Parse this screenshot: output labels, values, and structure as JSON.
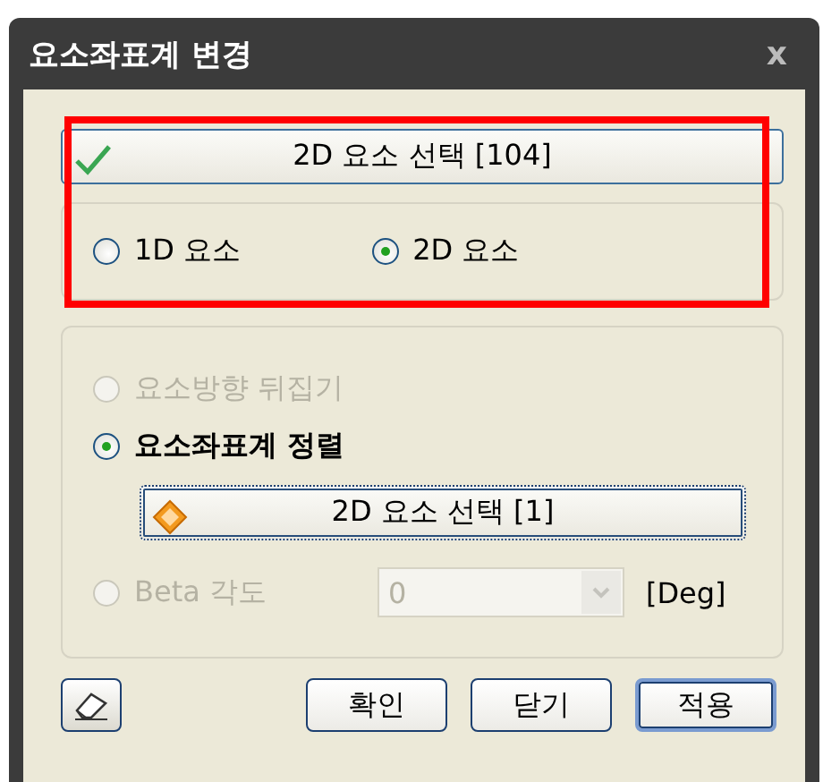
{
  "window": {
    "title": "요소좌표계 변경",
    "close": "x"
  },
  "select_button": {
    "label": "2D 요소 선택 [104]"
  },
  "element_type": [
    {
      "label": "1D 요소",
      "selected": false
    },
    {
      "label": "2D 요소",
      "selected": true
    }
  ],
  "options": [
    {
      "kind": "radio",
      "label": "요소방향 뒤집기",
      "selected": false,
      "disabled": true
    },
    {
      "kind": "radio",
      "label": "요소좌표계 정렬",
      "selected": true,
      "disabled": false
    },
    {
      "kind": "select",
      "label": "2D 요소 선택 [1]"
    },
    {
      "kind": "angle",
      "label": "Beta 각도",
      "selected": false,
      "disabled": true,
      "value": "0",
      "unit": "[Deg]"
    }
  ],
  "buttons": [
    {
      "label": "확인",
      "default": false
    },
    {
      "label": "닫기",
      "default": false
    },
    {
      "label": "적용",
      "default": true
    }
  ]
}
